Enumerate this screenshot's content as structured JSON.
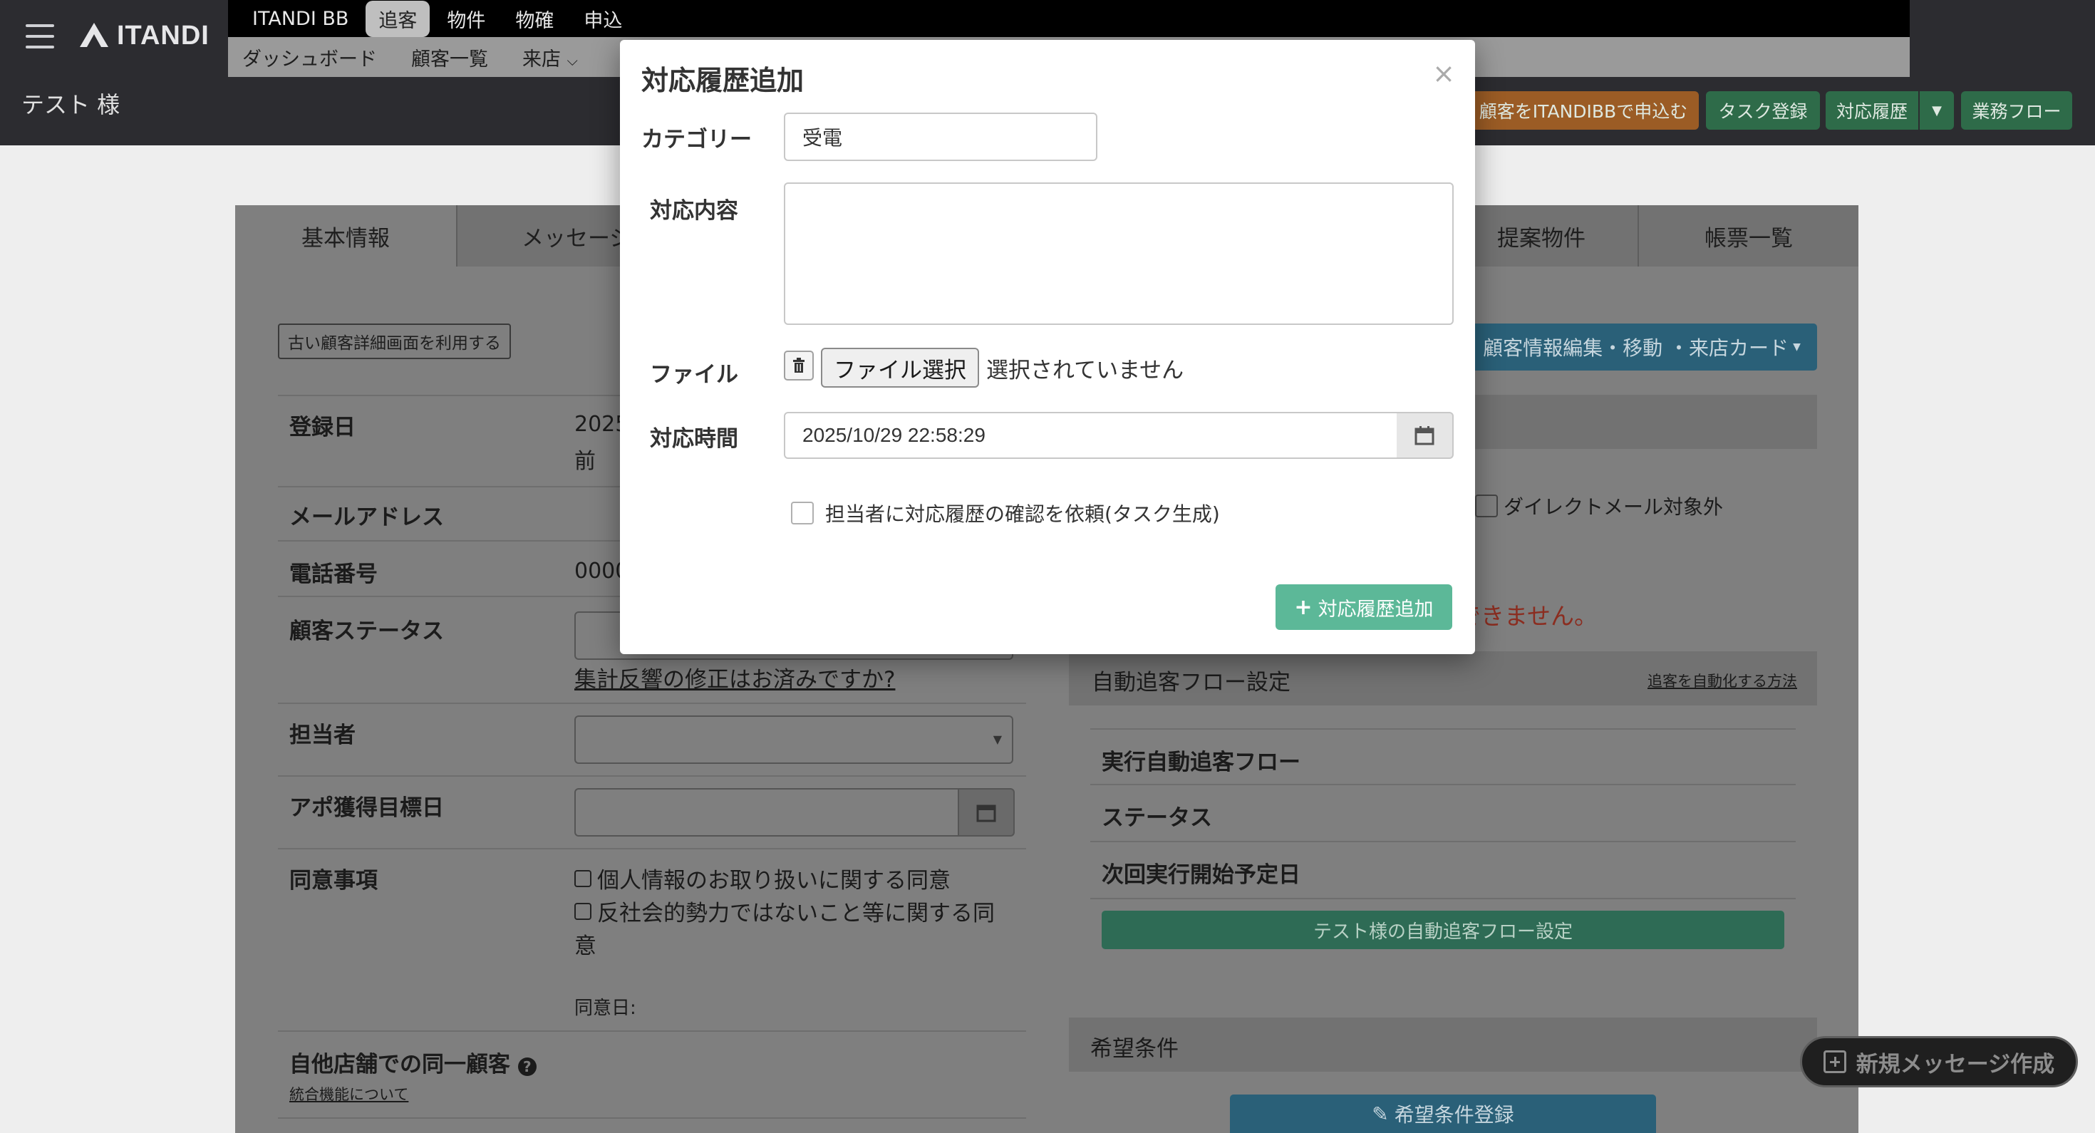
{
  "header": {
    "logo_text": "ITANDI",
    "primary_nav": [
      "ITANDI BB",
      "追客",
      "物件",
      "物確",
      "申込"
    ],
    "primary_active": "追客",
    "secondary_nav": [
      "ダッシュボード",
      "顧客一覧",
      "来店"
    ],
    "page_title": "テスト 様",
    "buttons": {
      "apply": "顧客をITANDIBBで申込む",
      "task": "タスク登録",
      "history": "対応履歴",
      "workflow": "業務フロー"
    }
  },
  "tabs": [
    "基本情報",
    "メッセージ",
    "提案物件",
    "帳票一覧"
  ],
  "left_panel": {
    "old_screen_button": "古い顧客詳細画面を利用する",
    "fields": {
      "registered_label": "登録日",
      "registered_value": "2025",
      "registered_value2": "前",
      "email_label": "メールアドレス",
      "phone_label": "電話番号",
      "phone_value": "0000",
      "status_label": "顧客ステータス",
      "status_link": "集計反響の修正はお済みですか?",
      "assignee_label": "担当者",
      "appt_label": "アポ獲得目標日",
      "consent_label": "同意事項",
      "consent_items": [
        "個人情報のお取り扱いに関する同意",
        "反社会的勢力ではないこと等に関する同",
        "意"
      ],
      "consent_date": "同意日:",
      "same_customer_label": "自他店舗での同一顧客",
      "merge_link": "統合機能について"
    }
  },
  "right_panel": {
    "edit_button": "顧客情報編集・移動 ・来店カード",
    "dm_exclude": "ダイレクトメール対象外",
    "warning": "ができません。",
    "auto_flow_title": "自動追客フロー設定",
    "auto_flow_link": "追客を自動化する方法",
    "rows": [
      "実行自動追客フロー",
      "ステータス",
      "次回実行開始予定日"
    ],
    "auto_flow_button": "テスト様の自動追客フロー設定",
    "conditions_title": "希望条件",
    "conditions_button": "希望条件登録"
  },
  "floating": {
    "new_message": "新規メッセージ作成"
  },
  "modal": {
    "title": "対応履歴追加",
    "close": "×",
    "category_label": "カテゴリー",
    "category_value": "受電",
    "content_label": "対応内容",
    "content_value": "",
    "file_label": "ファイル",
    "file_button": "ファイル選択",
    "file_status": "選択されていません",
    "time_label": "対応時間",
    "time_value": "2025/10/29 22:58:29",
    "task_check_label": "担当者に対応履歴の確認を依頼(タスク生成)",
    "submit": "対応履歴追加"
  }
}
